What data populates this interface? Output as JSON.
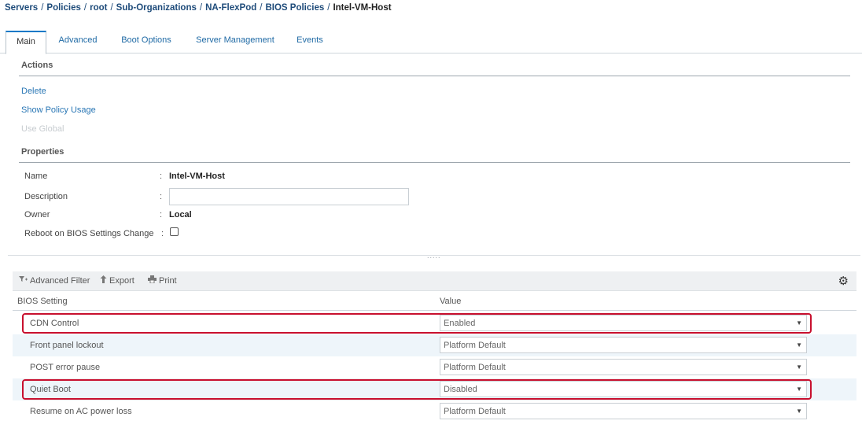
{
  "breadcrumb": {
    "items": [
      "Servers",
      "Policies",
      "root",
      "Sub-Organizations",
      "NA-FlexPod",
      "BIOS Policies"
    ],
    "current": "Intel-VM-Host",
    "separator": "/"
  },
  "tabs": [
    {
      "label": "Main",
      "active": true
    },
    {
      "label": "Advanced",
      "active": false
    },
    {
      "label": "Boot Options",
      "active": false
    },
    {
      "label": "Server Management",
      "active": false
    },
    {
      "label": "Events",
      "active": false
    }
  ],
  "actions": {
    "title": "Actions",
    "delete": "Delete",
    "show_policy_usage": "Show Policy Usage",
    "use_global": "Use Global"
  },
  "properties": {
    "title": "Properties",
    "name_label": "Name",
    "name_value": "Intel-VM-Host",
    "description_label": "Description",
    "description_value": "",
    "owner_label": "Owner",
    "owner_value": "Local",
    "reboot_label": "Reboot on BIOS Settings Change",
    "reboot_checked": false,
    "colon": ":"
  },
  "splitter": {
    "grip": "....."
  },
  "toolbar": {
    "advanced_filter": "Advanced Filter",
    "export": "Export",
    "print": "Print",
    "settings_icon": "gear-icon"
  },
  "table": {
    "columns": [
      "BIOS Setting",
      "Value"
    ],
    "rows": [
      {
        "setting": "CDN Control",
        "value": "Enabled",
        "highlighted": true
      },
      {
        "setting": "Front panel lockout",
        "value": "Platform Default",
        "highlighted": false
      },
      {
        "setting": "POST error pause",
        "value": "Platform Default",
        "highlighted": false
      },
      {
        "setting": "Quiet Boot",
        "value": "Disabled",
        "highlighted": true
      },
      {
        "setting": "Resume on AC power loss",
        "value": "Platform Default",
        "highlighted": false
      }
    ]
  },
  "colors": {
    "link": "#2a77b5",
    "breadcrumb": "#1e4b7a",
    "active_tab_accent": "#0a79c7",
    "highlight_border": "#c8102e",
    "alt_row": "#eef5fa"
  }
}
